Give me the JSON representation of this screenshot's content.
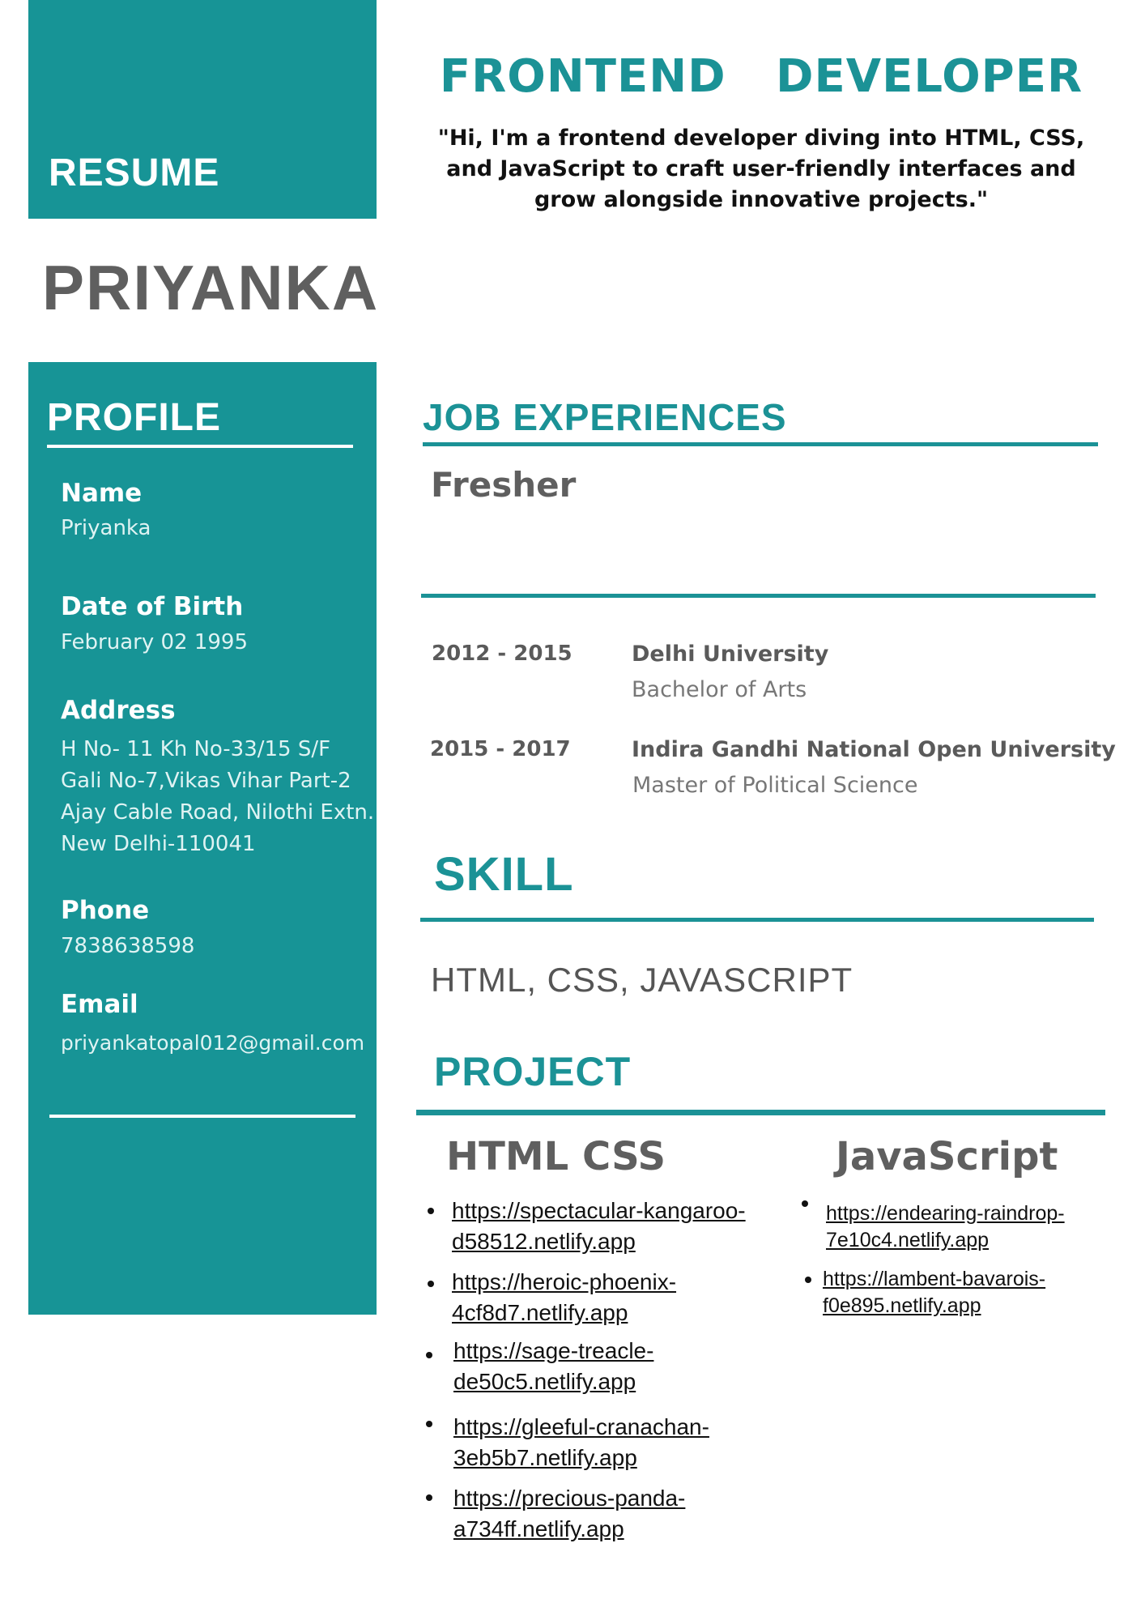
{
  "header": {
    "resume_label": "RESUME",
    "name": "PRIYANKA",
    "job_title": "FRONTEND   DEVELOPER",
    "summary": "\"Hi, I'm a  frontend developer diving into HTML, CSS, and JavaScript to craft user-friendly interfaces and grow alongside innovative projects.\""
  },
  "profile": {
    "heading": "PROFILE",
    "name_label": "Name",
    "name_value": "Priyanka",
    "dob_label": "Date of Birth",
    "dob_value": "February 02 1995",
    "address_label": "Address",
    "address_lines": [
      "H No- 11 Kh No-33/15 S/F",
      "Gali No-7,Vikas Vihar Part-2",
      "Ajay Cable Road, Nilothi Extn.",
      "New Delhi-110041"
    ],
    "phone_label": "Phone",
    "phone_value": "7838638598",
    "email_label": "Email",
    "email_value": "priyankatopal012@gmail.com"
  },
  "experience": {
    "heading": "JOB EXPERIENCES",
    "status": "Fresher"
  },
  "education": [
    {
      "years": "2012 - 2015",
      "institution": "Delhi University",
      "degree": "Bachelor of Arts"
    },
    {
      "years": "2015 - 2017",
      "institution": "Indira Gandhi National Open University",
      "degree": "Master of Political Science"
    }
  ],
  "skill": {
    "heading": "SKILL",
    "items": "HTML, CSS, JAVASCRIPT"
  },
  "project": {
    "heading": "PROJECT",
    "html_css": {
      "title": "HTML CSS",
      "links": [
        [
          "https://spectacular-kangaroo-",
          "d58512.netlify.app"
        ],
        [
          "https://heroic-phoenix-",
          "4cf8d7.netlify.app"
        ],
        [
          "https://sage-treacle-",
          "de50c5.netlify.app"
        ],
        [
          "https://gleeful-cranachan-",
          "3eb5b7.netlify.app"
        ],
        [
          "https://precious-panda-",
          "a734ff.netlify.app"
        ]
      ]
    },
    "javascript": {
      "title": "JavaScript",
      "links": [
        [
          "https://endearing-raindrop-",
          "7e10c4.netlify.app"
        ],
        [
          "https://lambent-bavarois-",
          "f0e895.netlify.app"
        ]
      ]
    }
  },
  "colors": {
    "accent": "#179496",
    "heading_teal": "#1b9296",
    "dark_gray": "#5f5f5f"
  }
}
